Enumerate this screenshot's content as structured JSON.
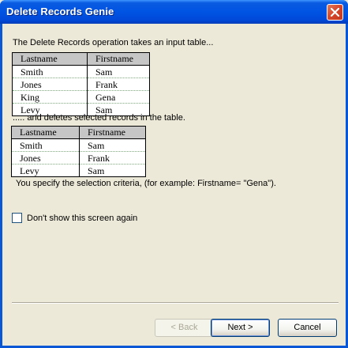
{
  "window": {
    "title": "Delete Records Genie"
  },
  "intro": "The Delete Records operation takes an input table...",
  "input_table": {
    "headers": [
      "Lastname",
      "Firstname"
    ],
    "rows": [
      [
        "Smith",
        "Sam"
      ],
      [
        "Jones",
        "Frank"
      ],
      [
        "King",
        "Gena"
      ],
      [
        "Levy",
        "Sam"
      ]
    ]
  },
  "middle_text": "..... and deletes selected records in the table.",
  "output_table": {
    "headers": [
      "Lastname",
      "Firstname"
    ],
    "rows": [
      [
        "Smith",
        "Sam"
      ],
      [
        "Jones",
        "Frank"
      ],
      [
        "Levy",
        "Sam"
      ]
    ]
  },
  "criteria_text": "You specify the selection criteria, (for example: Firstname= \"Gena\").",
  "checkbox": {
    "label": "Don't show this screen again",
    "checked": false
  },
  "buttons": {
    "back": "< Back",
    "next": "Next >",
    "cancel": "Cancel"
  }
}
